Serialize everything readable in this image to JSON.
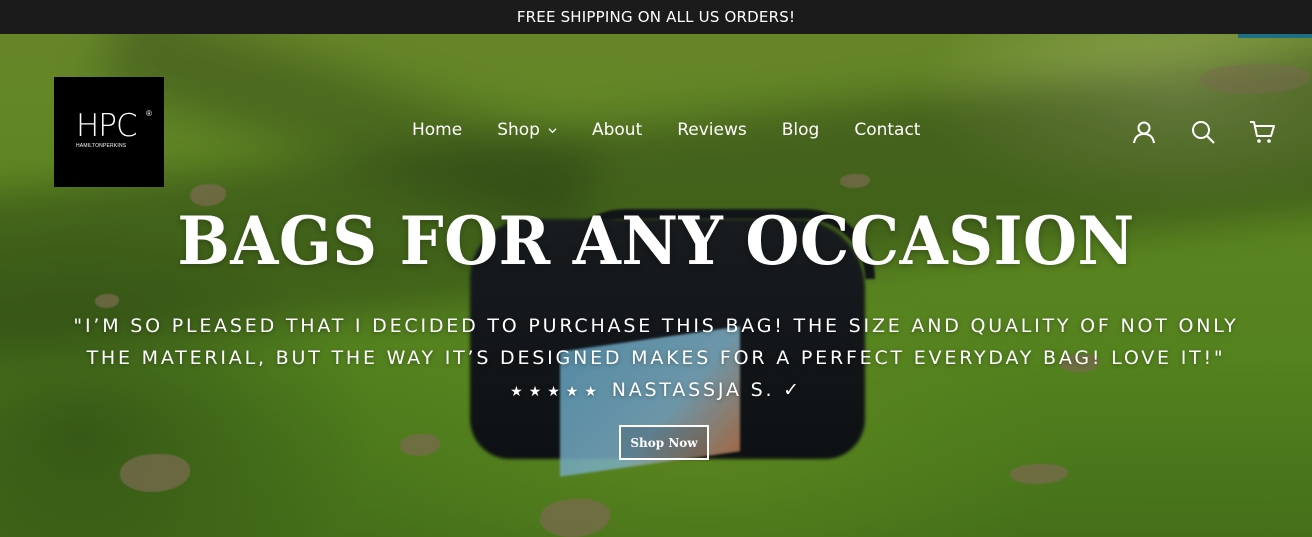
{
  "announcement": {
    "text": "FREE SHIPPING ON ALL US ORDERS!"
  },
  "logo": {
    "main": "HPC",
    "registered": "®",
    "sub": "HAMILTONPERKINS"
  },
  "nav": {
    "items": [
      {
        "label": "Home",
        "has_dropdown": false
      },
      {
        "label": "Shop",
        "has_dropdown": true
      },
      {
        "label": "About",
        "has_dropdown": false
      },
      {
        "label": "Reviews",
        "has_dropdown": false
      },
      {
        "label": "Blog",
        "has_dropdown": false
      },
      {
        "label": "Contact",
        "has_dropdown": false
      }
    ]
  },
  "header_icons": [
    "account-icon",
    "search-icon",
    "cart-icon"
  ],
  "hero": {
    "title": "BAGS FOR ANY OCCASION",
    "quote_part1": "\"I’m so pleased that I decided to purchase this bag! The size and quality of not only the material, but the way it’s designed makes for a perfect everyday bag! Love it!\"",
    "stars": "★★★★★",
    "quote_author": "Nastassja S.",
    "quote_check": "✓",
    "button_label": "Shop Now"
  },
  "colors": {
    "announcement_bg": "#1b1b1b",
    "text": "#ffffff",
    "accent": "#1f6f84",
    "logo_bg": "#000000"
  }
}
